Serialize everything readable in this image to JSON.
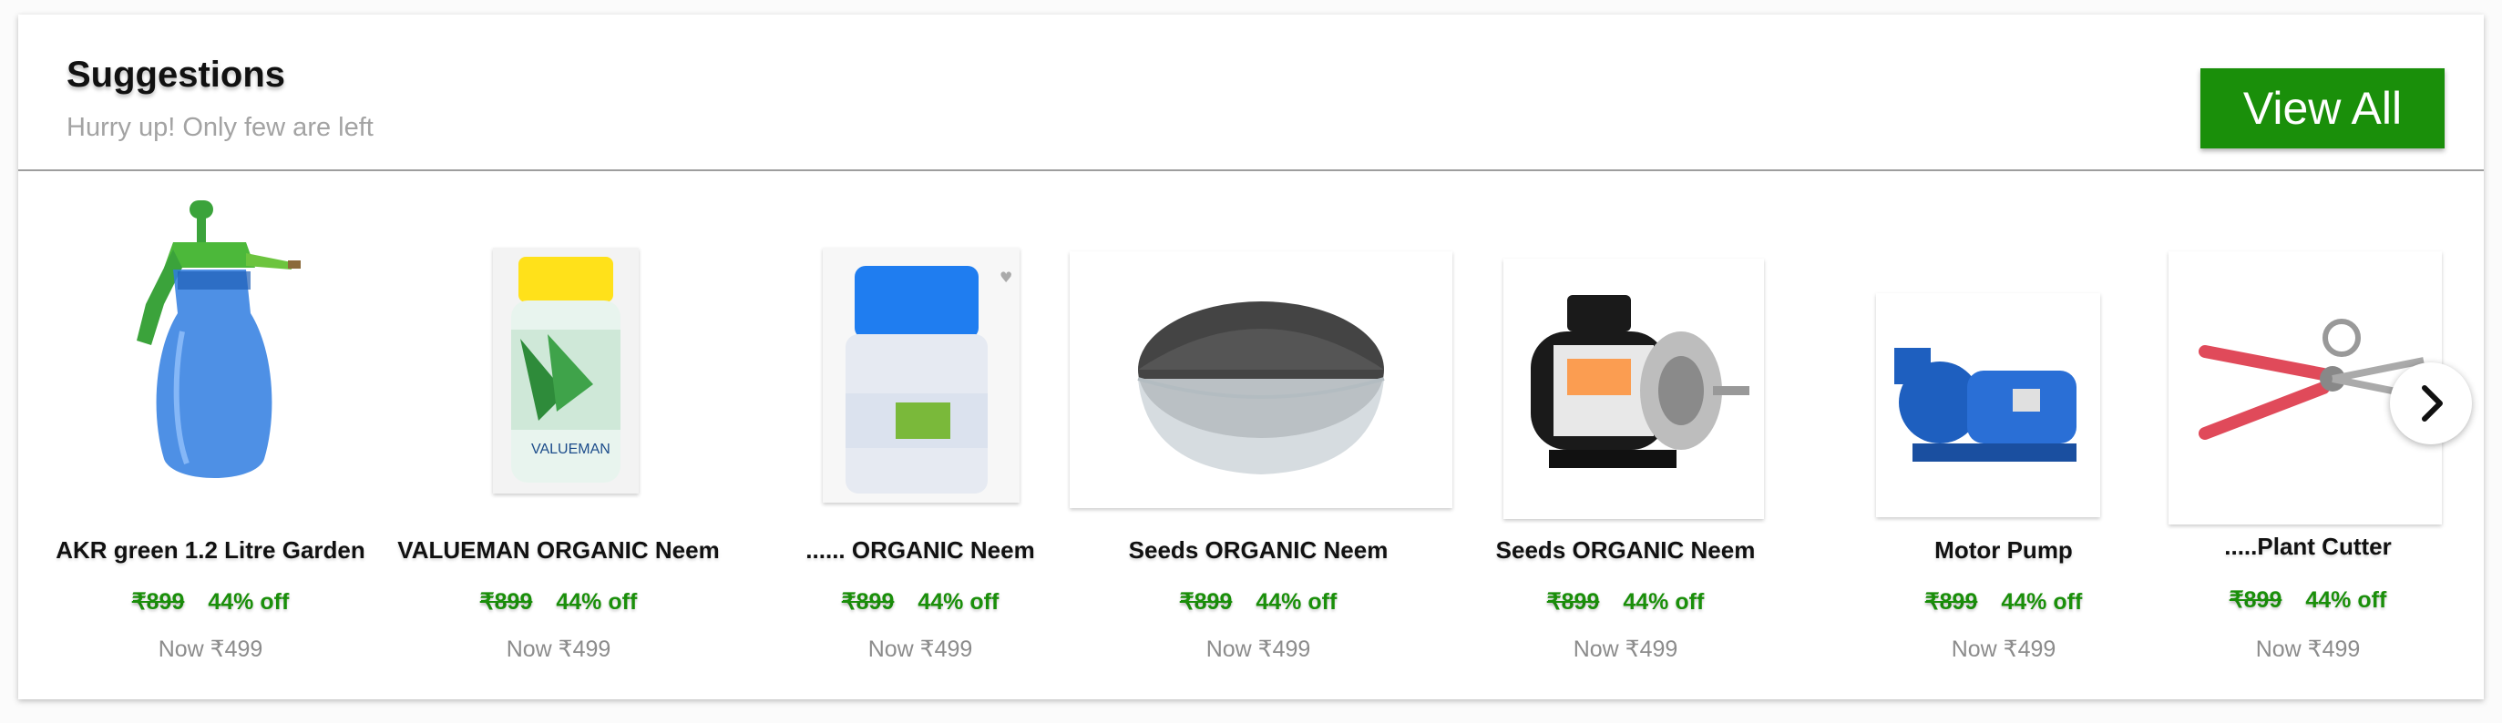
{
  "header": {
    "title": "Suggestions",
    "subtitle": "Hurry up! Only few are left",
    "view_all_label": "View All"
  },
  "products": [
    {
      "name": "AKR green 1.2 Litre Garden",
      "old_price": "₹899",
      "discount": "44% off",
      "now_price": "Now ₹499",
      "image_icon": "sprayer-image"
    },
    {
      "name": "VALUEMAN ORGANIC Neem",
      "old_price": "₹899",
      "discount": "44% off",
      "now_price": "Now ₹499",
      "image_icon": "neem-bottle-image",
      "image_text": "VALUEMAN"
    },
    {
      "name": "...... ORGANIC Neem",
      "old_price": "₹899",
      "discount": "44% off",
      "now_price": "Now ₹499",
      "image_icon": "blue-cap-bottle-image"
    },
    {
      "name": "Seeds ORGANIC Neem",
      "old_price": "₹899",
      "discount": "44% off",
      "now_price": "Now ₹499",
      "image_icon": "seeds-bowl-image"
    },
    {
      "name": "Seeds ORGANIC Neem",
      "old_price": "₹899",
      "discount": "44% off",
      "now_price": "Now ₹499",
      "image_icon": "electric-motor-image"
    },
    {
      "name": "Motor Pump",
      "old_price": "₹899",
      "discount": "44% off",
      "now_price": "Now ₹499",
      "image_icon": "water-pump-image"
    },
    {
      "name": ".....Plant Cutter",
      "old_price": "₹899",
      "discount": "44% off",
      "now_price": "Now ₹499",
      "image_icon": "pruning-shears-image"
    }
  ],
  "colors": {
    "accent_green": "#1a8f0a",
    "muted_text": "#8c8c8c"
  },
  "carousel": {
    "next_icon": "chevron-right-icon"
  }
}
